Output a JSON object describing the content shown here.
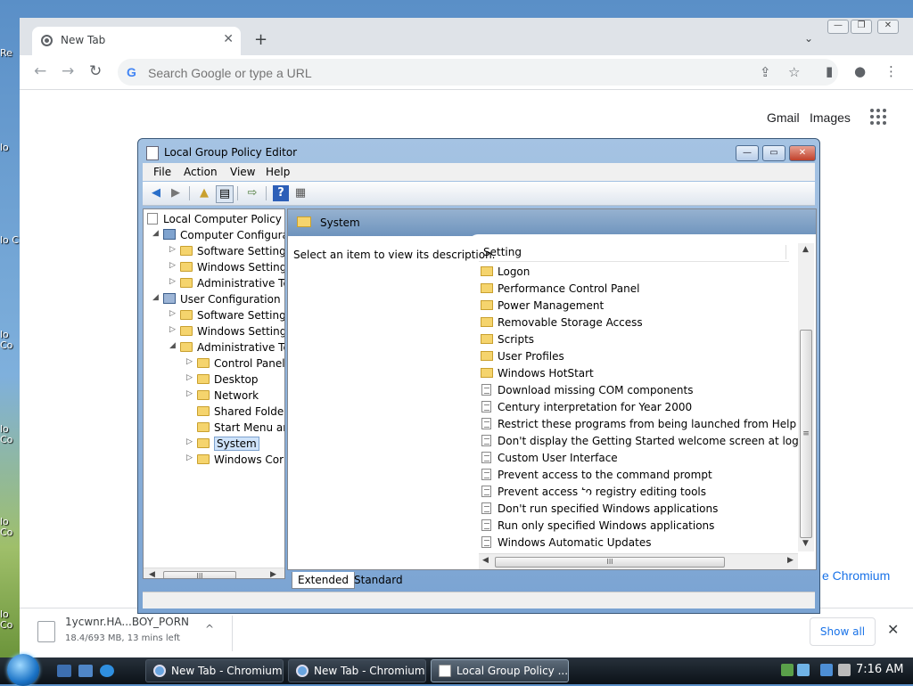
{
  "desktop": {
    "icons": [
      "Re",
      "lo",
      "lo C",
      "lo Co",
      "lo Co",
      "lo Co",
      "lo Co"
    ]
  },
  "browser": {
    "tab": {
      "title": "New Tab",
      "close": "✕"
    },
    "new_tab": "+",
    "tabs_dropdown": "⌄",
    "window_controls": {
      "minimize": "—",
      "maximize": "❐",
      "close": "✕"
    },
    "nav": {
      "back": "←",
      "forward": "→",
      "reload": "↻"
    },
    "omnibox": {
      "placeholder": "Search Google or type a URL",
      "g_icon": "G"
    },
    "toolbar_icons": {
      "share": "⇪",
      "bookmark": "☆",
      "sidebar": "▮",
      "profile": "●",
      "menu": "⋮"
    },
    "links": {
      "gmail": "Gmail",
      "images": "Images"
    },
    "ntp_footer_link": "e Chromium",
    "download": {
      "filename": "1ycwnr.HA...BOY_PORN",
      "status": "18.4/693 MB, 13 mins left",
      "menu": "^",
      "show_all": "Show all",
      "close": "✕"
    }
  },
  "gpe": {
    "title": "Local Group Policy Editor",
    "buttons": {
      "min": "—",
      "max": "▭",
      "close": "✕"
    },
    "menu": [
      "File",
      "Action",
      "View",
      "Help"
    ],
    "toolbar_icons": [
      "back-icon",
      "forward-icon",
      "up-folder-icon",
      "show-hide-tree-icon",
      "export-list-icon",
      "help-icon",
      "properties-icon"
    ],
    "tree": [
      {
        "label": "Local Computer Policy",
        "exp": "",
        "icon": "policy"
      },
      {
        "label": "Computer Configura",
        "exp": "◢",
        "icon": "computer"
      },
      {
        "label": "Software Settings",
        "exp": "▷",
        "icon": "folder"
      },
      {
        "label": "Windows Setting",
        "exp": "▷",
        "icon": "folder"
      },
      {
        "label": "Administrative Te",
        "exp": "▷",
        "icon": "folder"
      },
      {
        "label": "User Configuration",
        "exp": "◢",
        "icon": "user"
      },
      {
        "label": "Software Settings",
        "exp": "▷",
        "icon": "folder"
      },
      {
        "label": "Windows Setting",
        "exp": "▷",
        "icon": "folder"
      },
      {
        "label": "Administrative Te",
        "exp": "◢",
        "icon": "folder"
      },
      {
        "label": "Control Panel",
        "exp": "▷",
        "icon": "folder"
      },
      {
        "label": "Desktop",
        "exp": "▷",
        "icon": "folder"
      },
      {
        "label": "Network",
        "exp": "▷",
        "icon": "folder"
      },
      {
        "label": "Shared Folder",
        "exp": "",
        "icon": "folder"
      },
      {
        "label": "Start Menu ar",
        "exp": "",
        "icon": "folder"
      },
      {
        "label": "System",
        "exp": "▷",
        "icon": "folder",
        "selected": true
      },
      {
        "label": "Windows Cor",
        "exp": "▷",
        "icon": "folder"
      }
    ],
    "pane": {
      "header": "System",
      "description": "Select an item to view its description.",
      "column": "Setting",
      "settings": [
        {
          "label": "Logon",
          "type": "folder"
        },
        {
          "label": "Performance Control Panel",
          "type": "folder"
        },
        {
          "label": "Power Management",
          "type": "folder"
        },
        {
          "label": "Removable Storage Access",
          "type": "folder"
        },
        {
          "label": "Scripts",
          "type": "folder"
        },
        {
          "label": "User Profiles",
          "type": "folder"
        },
        {
          "label": "Windows HotStart",
          "type": "folder"
        },
        {
          "label": "Download missing COM components",
          "type": "setting"
        },
        {
          "label": "Century interpretation for Year 2000",
          "type": "setting"
        },
        {
          "label": "Restrict these programs from being launched from Help",
          "type": "setting"
        },
        {
          "label": "Don't display the Getting Started welcome screen at logon",
          "type": "setting"
        },
        {
          "label": "Custom User Interface",
          "type": "setting"
        },
        {
          "label": "Prevent access to the command prompt",
          "type": "setting"
        },
        {
          "label": "Prevent access to registry editing tools",
          "type": "setting"
        },
        {
          "label": "Don't run specified Windows applications",
          "type": "setting"
        },
        {
          "label": "Run only specified Windows applications",
          "type": "setting"
        },
        {
          "label": "Windows Automatic Updates",
          "type": "setting"
        }
      ]
    },
    "view_tabs": {
      "extended": "Extended",
      "standard": "Standard"
    },
    "scroll": {
      "left": "◀",
      "right": "▶",
      "up": "▲",
      "down": "▼",
      "grip": "III",
      "vgrip": "≡"
    }
  },
  "taskbar": {
    "tasks": [
      {
        "label": "New Tab - Chromium",
        "icon": "chromium"
      },
      {
        "label": "New Tab - Chromium",
        "icon": "chromium"
      },
      {
        "label": "Local Group Policy ...",
        "icon": "gpe",
        "active": true
      }
    ],
    "clock": "7:16 AM"
  }
}
